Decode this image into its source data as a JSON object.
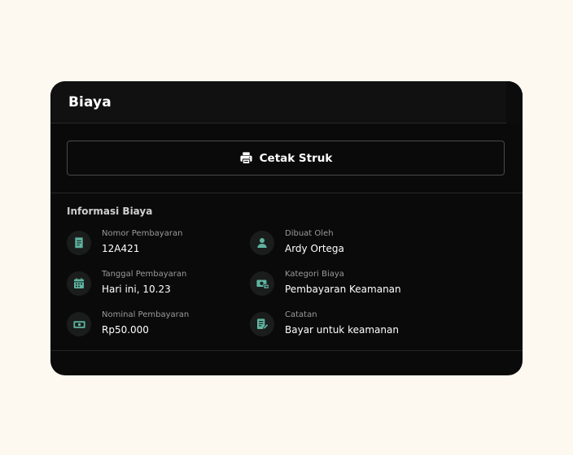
{
  "header": {
    "title": "Biaya"
  },
  "actions": {
    "print_label": "Cetak Struk",
    "print_icon": "printer-icon"
  },
  "info": {
    "section_title": "Informasi Biaya",
    "accent_color": "#5fb4a0",
    "items": [
      {
        "icon": "receipt-icon",
        "label": "Nomor Pembayaran",
        "value": "12A421"
      },
      {
        "icon": "user-icon",
        "label": "Dibuat Oleh",
        "value": "Ardy Ortega"
      },
      {
        "icon": "calendar-icon",
        "label": "Tanggal Pembayaran",
        "value": "Hari ini, 10.23"
      },
      {
        "icon": "money-transfer-icon",
        "label": "Kategori Biaya",
        "value": "Pembayaran Keamanan"
      },
      {
        "icon": "cash-icon",
        "label": "Nominal Pembayaran",
        "value": "Rp50.000"
      },
      {
        "icon": "note-edit-icon",
        "label": "Catatan",
        "value": "Bayar untuk keamanan"
      }
    ]
  }
}
